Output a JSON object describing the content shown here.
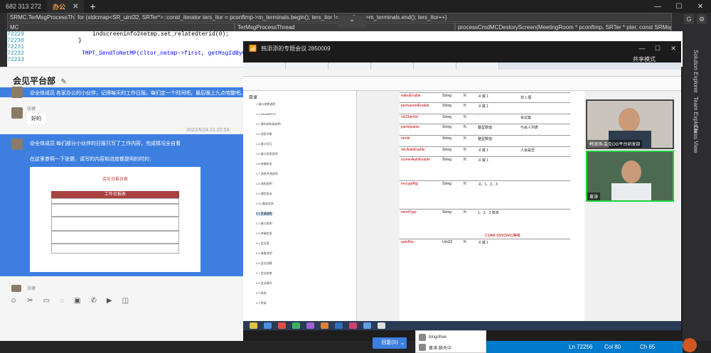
{
  "tabs": [
    {
      "label": "682 313 272"
    },
    {
      "label": "办公",
      "active": true
    }
  ],
  "vs": {
    "dropdown_file": "SRMC.TerMsgProcessTh",
    "dropdown_scope": "for (stdcmap<SR_uint32, SRTer*>::const_iterator ters_itor = pconftmp->m_terminals.begin(); ters_itor != pconftmp->m_terminals.end(); ters_itor++)",
    "dropdown_proj": "MC",
    "dropdown_class": "TerMsgProcessThread",
    "dropdown_method": "processCmdMCDestoryScreen(MeetingRoom * pconftmp, SRTer * pter, const SRMsgs::CmdMCDest",
    "lines": [
      {
        "no": "72229",
        "text": "indscreeninfo2netmp.set_relatedterid(0);"
      },
      {
        "no": "72230",
        "text": "}"
      },
      {
        "no": "72231",
        "text": ""
      },
      {
        "no": "72232",
        "text": "TMPT_SendToNetMP(cltor_netmp->first, getMsgIdByClassName(IndCo"
      },
      {
        "no": "72233",
        "text": ""
      }
    ],
    "status_ln": "Ln 72256",
    "status_col": "Col 80",
    "status_ch": "Ch 65",
    "side_labels": [
      "Solution Explorer",
      "Team Explorer",
      "Class View"
    ]
  },
  "chat": {
    "title": "会见平台部",
    "messages": [
      {
        "text": "@全体成员 各家办公的小伙伴，记得每天的工作日报。每们定一个时间吧，最后晚上九点咱整吧。"
      },
      {
        "name": "张健",
        "text": "好的"
      },
      {
        "time": "2022/5/24 21:22:59"
      },
      {
        "text": "@全体成员 每们部分小伙伴的日报只写了工作内容，完成情况全自看"
      },
      {
        "text": "在这里参照一下张健、请写的内容和进度都是明的时的："
      },
      {
        "name": "张健"
      }
    ],
    "doc_title": "会见日报日表",
    "doc_header": "工作日报表"
  },
  "meeting": {
    "title": "韩添添的专题会议 2850009",
    "share_label": "共享模式",
    "nav_title": "目录",
    "nav_items": [
      "1 接口参数说明",
      "1.1 MediaRELE",
      "1.2 通讯结构体说明",
      "1.3 消息对象",
      "1.4 接口交互",
      "1.5 接口异常说明",
      "1.6 终端状态",
      "1.7 消息传递说明",
      "1.8 流程说明",
      "1.9 通信协议",
      "1.10 服务状态",
      "2.1 目录结构",
      "2.2 接口说明",
      "2.3 终端信息",
      "2.4 会议室",
      "2.5 参数说明",
      "2.6 会议创建",
      "2.7 会议结束",
      "2.8 会议操作",
      "2.9 其他",
      "3.1 附录"
    ],
    "table": [
      {
        "field": "videoEnable",
        "type": "String",
        "req": "N",
        "default": "-0 或 1"
      },
      {
        "field": "permanentEnable",
        "type": "String",
        "req": "N",
        "default": "-0 或 1"
      },
      {
        "field": "chIClientId",
        "type": "String",
        "req": "N",
        "default": "-"
      },
      {
        "field": "participants",
        "type": "String",
        "req": "N",
        "default": "整型数值"
      },
      {
        "field": "mode",
        "type": "String",
        "req": "N",
        "default": "整型数值"
      },
      {
        "field": "micAutoEnable",
        "type": "String",
        "req": "N",
        "default": "-0 或 1"
      },
      {
        "field": "screenAutoEnable",
        "type": "String",
        "req": "N",
        "default": "-0 或 1"
      },
      {
        "field": "encryptAlg",
        "type": "String",
        "req": "N",
        "default": "-0、1、2、3"
      },
      {
        "field": "meetType",
        "type": "String",
        "req": "N",
        "default": "1、2、3 枚举"
      },
      {
        "field": "autoRec",
        "type": "Uint32",
        "req": "N",
        "default": "-0 或 1"
      }
    ],
    "cell_notes": [
      "非 1 局",
      "会议室",
      "与会人列表",
      "人会是否"
    ],
    "red_note": "CSAM-SM2(SM1)等级",
    "participants": [
      {
        "label": "韩添添-会见OG平台研发部"
      },
      {
        "label": "黄涛"
      }
    ]
  },
  "bottom": {
    "reply_label": "回复(S)",
    "notify_rows": [
      "bingofree",
      "黄涛·聊天中"
    ]
  }
}
